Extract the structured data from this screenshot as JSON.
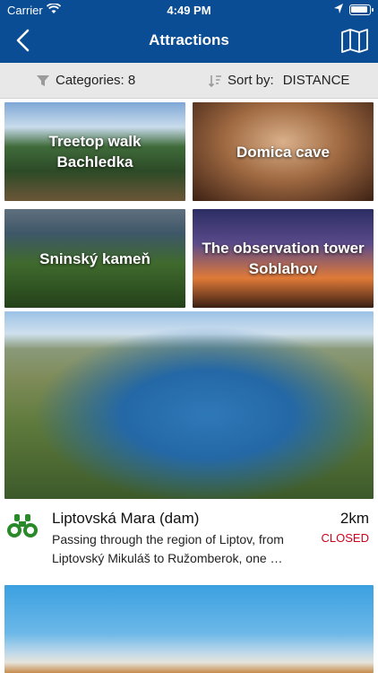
{
  "status_bar": {
    "carrier": "Carrier",
    "time": "4:49 PM"
  },
  "header": {
    "title": "Attractions",
    "back_icon": "chevron-left-icon",
    "map_icon": "map-icon",
    "background": "#0a4d94"
  },
  "filters": {
    "categories_label": "Categories: 8",
    "sort_label": "Sort by:",
    "sort_value": "DISTANCE"
  },
  "tiles": [
    {
      "label": "Treetop walk Bachledka"
    },
    {
      "label": "Domica cave"
    },
    {
      "label": "Sninský kameň"
    },
    {
      "label": "The observation tower Soblahov"
    }
  ],
  "featured": {
    "name": "Liptovská Mara (dam)",
    "distance": "2km",
    "status": "CLOSED",
    "status_color": "#d0021b",
    "description": "Passing through the region of Liptov, from Liptovský Mikuláš to Ružomberok, one …",
    "icon": "binoculars-icon",
    "icon_color": "#2a8a2a"
  }
}
